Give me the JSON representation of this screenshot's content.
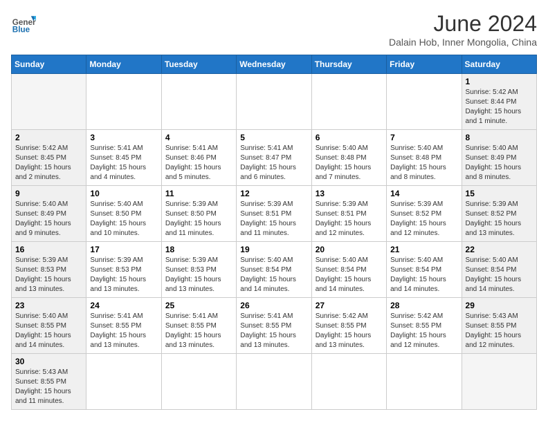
{
  "header": {
    "logo_general": "General",
    "logo_blue": "Blue",
    "cal_title": "June 2024",
    "cal_subtitle": "Dalain Hob, Inner Mongolia, China"
  },
  "weekdays": [
    "Sunday",
    "Monday",
    "Tuesday",
    "Wednesday",
    "Thursday",
    "Friday",
    "Saturday"
  ],
  "weeks": [
    [
      {
        "day": "",
        "info": ""
      },
      {
        "day": "",
        "info": ""
      },
      {
        "day": "",
        "info": ""
      },
      {
        "day": "",
        "info": ""
      },
      {
        "day": "",
        "info": ""
      },
      {
        "day": "",
        "info": ""
      },
      {
        "day": "1",
        "info": "Sunrise: 5:42 AM\nSunset: 8:44 PM\nDaylight: 15 hours and 1 minute."
      }
    ],
    [
      {
        "day": "2",
        "info": "Sunrise: 5:42 AM\nSunset: 8:45 PM\nDaylight: 15 hours and 2 minutes."
      },
      {
        "day": "3",
        "info": "Sunrise: 5:41 AM\nSunset: 8:45 PM\nDaylight: 15 hours and 4 minutes."
      },
      {
        "day": "4",
        "info": "Sunrise: 5:41 AM\nSunset: 8:46 PM\nDaylight: 15 hours and 5 minutes."
      },
      {
        "day": "5",
        "info": "Sunrise: 5:41 AM\nSunset: 8:47 PM\nDaylight: 15 hours and 6 minutes."
      },
      {
        "day": "6",
        "info": "Sunrise: 5:40 AM\nSunset: 8:48 PM\nDaylight: 15 hours and 7 minutes."
      },
      {
        "day": "7",
        "info": "Sunrise: 5:40 AM\nSunset: 8:48 PM\nDaylight: 15 hours and 8 minutes."
      },
      {
        "day": "8",
        "info": "Sunrise: 5:40 AM\nSunset: 8:49 PM\nDaylight: 15 hours and 8 minutes."
      }
    ],
    [
      {
        "day": "9",
        "info": "Sunrise: 5:40 AM\nSunset: 8:49 PM\nDaylight: 15 hours and 9 minutes."
      },
      {
        "day": "10",
        "info": "Sunrise: 5:40 AM\nSunset: 8:50 PM\nDaylight: 15 hours and 10 minutes."
      },
      {
        "day": "11",
        "info": "Sunrise: 5:39 AM\nSunset: 8:50 PM\nDaylight: 15 hours and 11 minutes."
      },
      {
        "day": "12",
        "info": "Sunrise: 5:39 AM\nSunset: 8:51 PM\nDaylight: 15 hours and 11 minutes."
      },
      {
        "day": "13",
        "info": "Sunrise: 5:39 AM\nSunset: 8:51 PM\nDaylight: 15 hours and 12 minutes."
      },
      {
        "day": "14",
        "info": "Sunrise: 5:39 AM\nSunset: 8:52 PM\nDaylight: 15 hours and 12 minutes."
      },
      {
        "day": "15",
        "info": "Sunrise: 5:39 AM\nSunset: 8:52 PM\nDaylight: 15 hours and 13 minutes."
      }
    ],
    [
      {
        "day": "16",
        "info": "Sunrise: 5:39 AM\nSunset: 8:53 PM\nDaylight: 15 hours and 13 minutes."
      },
      {
        "day": "17",
        "info": "Sunrise: 5:39 AM\nSunset: 8:53 PM\nDaylight: 15 hours and 13 minutes."
      },
      {
        "day": "18",
        "info": "Sunrise: 5:39 AM\nSunset: 8:53 PM\nDaylight: 15 hours and 13 minutes."
      },
      {
        "day": "19",
        "info": "Sunrise: 5:40 AM\nSunset: 8:54 PM\nDaylight: 15 hours and 14 minutes."
      },
      {
        "day": "20",
        "info": "Sunrise: 5:40 AM\nSunset: 8:54 PM\nDaylight: 15 hours and 14 minutes."
      },
      {
        "day": "21",
        "info": "Sunrise: 5:40 AM\nSunset: 8:54 PM\nDaylight: 15 hours and 14 minutes."
      },
      {
        "day": "22",
        "info": "Sunrise: 5:40 AM\nSunset: 8:54 PM\nDaylight: 15 hours and 14 minutes."
      }
    ],
    [
      {
        "day": "23",
        "info": "Sunrise: 5:40 AM\nSunset: 8:55 PM\nDaylight: 15 hours and 14 minutes."
      },
      {
        "day": "24",
        "info": "Sunrise: 5:41 AM\nSunset: 8:55 PM\nDaylight: 15 hours and 13 minutes."
      },
      {
        "day": "25",
        "info": "Sunrise: 5:41 AM\nSunset: 8:55 PM\nDaylight: 15 hours and 13 minutes."
      },
      {
        "day": "26",
        "info": "Sunrise: 5:41 AM\nSunset: 8:55 PM\nDaylight: 15 hours and 13 minutes."
      },
      {
        "day": "27",
        "info": "Sunrise: 5:42 AM\nSunset: 8:55 PM\nDaylight: 15 hours and 13 minutes."
      },
      {
        "day": "28",
        "info": "Sunrise: 5:42 AM\nSunset: 8:55 PM\nDaylight: 15 hours and 12 minutes."
      },
      {
        "day": "29",
        "info": "Sunrise: 5:43 AM\nSunset: 8:55 PM\nDaylight: 15 hours and 12 minutes."
      }
    ],
    [
      {
        "day": "30",
        "info": "Sunrise: 5:43 AM\nSunset: 8:55 PM\nDaylight: 15 hours and 11 minutes."
      },
      {
        "day": "",
        "info": ""
      },
      {
        "day": "",
        "info": ""
      },
      {
        "day": "",
        "info": ""
      },
      {
        "day": "",
        "info": ""
      },
      {
        "day": "",
        "info": ""
      },
      {
        "day": "",
        "info": ""
      }
    ]
  ]
}
